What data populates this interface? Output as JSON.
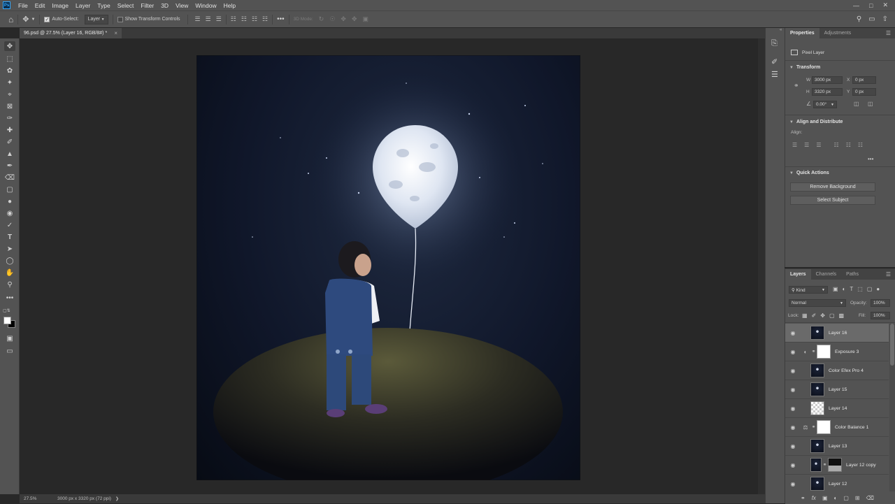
{
  "app": {
    "logo": "Ps"
  },
  "menu": [
    "File",
    "Edit",
    "Image",
    "Layer",
    "Type",
    "Select",
    "Filter",
    "3D",
    "View",
    "Window",
    "Help"
  ],
  "options": {
    "auto_select_label": "Auto-Select:",
    "auto_select_checked": true,
    "target": "Layer",
    "show_transform_label": "Show Transform Controls",
    "show_transform_checked": false,
    "mode3d_label": "3D Mode:"
  },
  "document": {
    "tab_title": "96.psd @ 27.5% (Layer 16, RGB/8#) *",
    "close_glyph": "×"
  },
  "status": {
    "zoom": "27.5%",
    "doc_info": "3000 px x 3320 px (72 ppi)"
  },
  "properties": {
    "tabs": [
      "Properties",
      "Adjustments"
    ],
    "layer_kind": "Pixel Layer",
    "transform_title": "Transform",
    "w_label": "W",
    "w_value": "3000 px",
    "h_label": "H",
    "h_value": "3320 px",
    "x_label": "X",
    "x_value": "0 px",
    "y_label": "Y",
    "y_value": "0 px",
    "angle_value": "0.00°",
    "align_title": "Align and Distribute",
    "align_label": "Align:",
    "quick_title": "Quick Actions",
    "remove_bg": "Remove Background",
    "select_subject": "Select Subject",
    "more": "•••"
  },
  "layers_panel": {
    "tabs": [
      "Layers",
      "Channels",
      "Paths"
    ],
    "filter_kind": "Kind",
    "blend_mode": "Normal",
    "opacity_label": "Opacity:",
    "opacity_value": "100%",
    "lock_label": "Lock:",
    "fill_label": "Fill:",
    "fill_value": "100%",
    "bottom_fx": "fx",
    "layers": [
      {
        "name": "Layer 16",
        "type": "pixel",
        "selected": true
      },
      {
        "name": "Exposure 3",
        "type": "adjustment"
      },
      {
        "name": "Color Efex Pro 4",
        "type": "pixel"
      },
      {
        "name": "Layer 15",
        "type": "pixel"
      },
      {
        "name": "Layer 14",
        "type": "transparent"
      },
      {
        "name": "Color Balance 1",
        "type": "adjustment"
      },
      {
        "name": "Layer 13",
        "type": "pixel"
      },
      {
        "name": "Layer 12 copy",
        "type": "masked"
      },
      {
        "name": "Layer 12",
        "type": "pixel"
      }
    ]
  },
  "colors": {
    "panel": "#535353",
    "canvas_bg": "#282828",
    "accent": "#31a8ff"
  }
}
